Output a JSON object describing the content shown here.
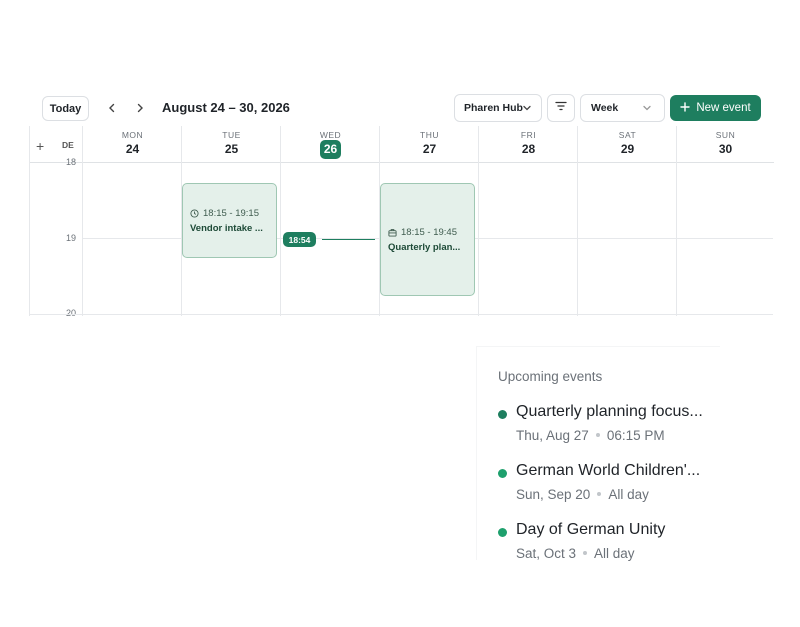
{
  "toolbar": {
    "today_label": "Today",
    "prev_icon": "chevron-left-icon",
    "next_icon": "chevron-right-icon",
    "range_title": "August 24 – 30, 2026",
    "hub_value": "Pharen Hub",
    "view_value": "Week",
    "new_event_label": "New event",
    "accent_color": "#1e7e5f"
  },
  "grid": {
    "add_label": "+",
    "tz_label": "DE",
    "hours": [
      "18",
      "19",
      "20"
    ],
    "days": [
      {
        "dow": "MON",
        "dom": "24",
        "today": false
      },
      {
        "dow": "TUE",
        "dom": "25",
        "today": false
      },
      {
        "dow": "WED",
        "dom": "26",
        "today": true
      },
      {
        "dow": "THU",
        "dom": "27",
        "today": false
      },
      {
        "dow": "FRI",
        "dom": "28",
        "today": false
      },
      {
        "dow": "SAT",
        "dom": "29",
        "today": false
      },
      {
        "dow": "SUN",
        "dom": "30",
        "today": false
      }
    ],
    "events": [
      {
        "day": "TUE",
        "time": "18:15 - 19:15",
        "title": "Vendor intake ...",
        "icon": "clock-icon"
      },
      {
        "day": "THU",
        "time": "18:15 - 19:45",
        "title": "Quarterly plan...",
        "icon": "briefcase-icon"
      }
    ],
    "now_time": "18:54"
  },
  "upcoming": {
    "title": "Upcoming events",
    "items": [
      {
        "name": "Quarterly planning focus...",
        "date": "Thu, Aug 27",
        "time": "06:15 PM"
      },
      {
        "name": "German World Children'...",
        "date": "Sun, Sep 20",
        "time": "All day"
      },
      {
        "name": "Day of German Unity",
        "date": "Sat, Oct 3",
        "time": "All day"
      }
    ]
  }
}
